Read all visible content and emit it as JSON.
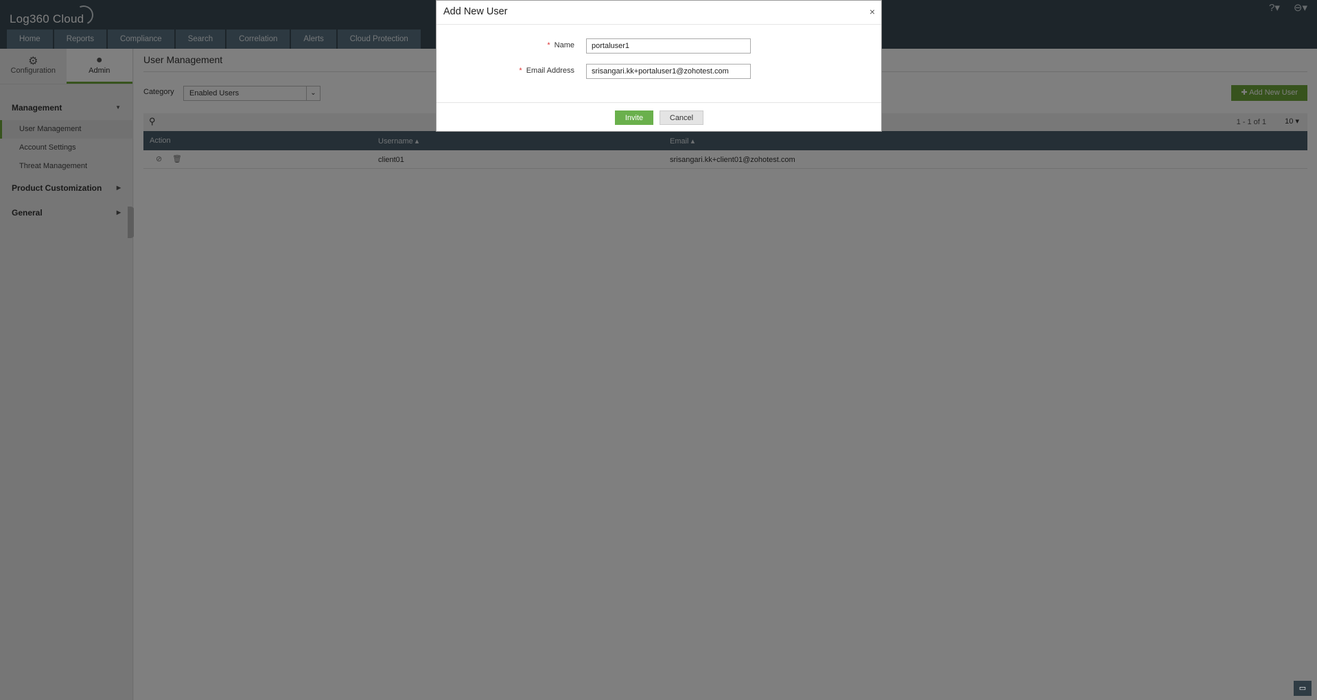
{
  "app": {
    "logo_text": "Log360 Cloud"
  },
  "nav": [
    {
      "label": "Home"
    },
    {
      "label": "Reports"
    },
    {
      "label": "Compliance"
    },
    {
      "label": "Search"
    },
    {
      "label": "Correlation"
    },
    {
      "label": "Alerts"
    },
    {
      "label": "Cloud Protection"
    }
  ],
  "top_icons": {
    "help": "?▾",
    "user": "⊖▾"
  },
  "sidebar": {
    "tabs": [
      {
        "label": "Configuration",
        "icon": "gear-icon"
      },
      {
        "label": "Admin",
        "icon": "person-icon"
      }
    ],
    "sections": [
      {
        "label": "Management",
        "items": [
          "User Management",
          "Account Settings",
          "Threat Management"
        ]
      },
      {
        "label": "Product Customization"
      },
      {
        "label": "General"
      }
    ]
  },
  "main": {
    "title": "User Management",
    "category_label": "Category",
    "category_value": "Enabled Users",
    "add_button": "Add New User",
    "pager": "1 - 1 of 1",
    "page_size": "10",
    "columns": [
      "Action",
      "Username",
      "Email"
    ],
    "rows": [
      {
        "username": "client01",
        "email": "srisangari.kk+client01@zohotest.com"
      }
    ]
  },
  "dialog": {
    "title": "Add New User",
    "close": "×",
    "fields": [
      {
        "label": "Name",
        "value": "portaluser1"
      },
      {
        "label": "Email Address",
        "value": "srisangari.kk+portaluser1@zohotest.com"
      }
    ],
    "invite": "Invite",
    "cancel": "Cancel"
  }
}
